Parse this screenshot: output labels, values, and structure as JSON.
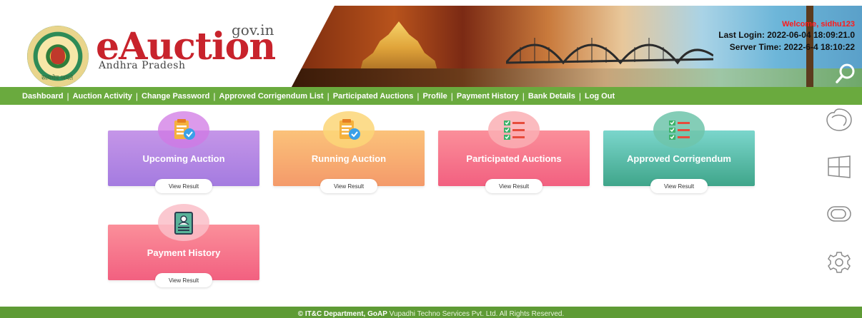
{
  "header": {
    "brand": "eAuction",
    "domain_suffix": "gov.in",
    "state": "Andhra Pradesh",
    "seal_tagline": "सत्यमेव जयते",
    "welcome": "Welcome, sidhu123",
    "last_login": "Last Login: 2022-06-04 18:09:21.0",
    "server_time": "Server Time: 2022-6-4 18:10:22",
    "search_icon": "search-icon"
  },
  "nav": {
    "items": [
      {
        "label": "Dashboard"
      },
      {
        "label": "Auction Activity"
      },
      {
        "label": "Change Password"
      },
      {
        "label": "Approved Corrigendum List"
      },
      {
        "label": "Participated Auctions"
      },
      {
        "label": "Profile"
      },
      {
        "label": "Payment History"
      },
      {
        "label": "Bank Details"
      },
      {
        "label": "Log Out"
      }
    ]
  },
  "cards": [
    {
      "title": "Upcoming Auction",
      "button": "View Result",
      "icon": "clipboard-check-icon"
    },
    {
      "title": "Running Auction",
      "button": "View Result",
      "icon": "clipboard-check-icon"
    },
    {
      "title": "Participated Auctions",
      "button": "View Result",
      "icon": "checklist-icon"
    },
    {
      "title": "Approved Corrigendum",
      "button": "View Result",
      "icon": "checklist-icon"
    },
    {
      "title": "Payment History",
      "button": "View Result",
      "icon": "id-card-icon"
    }
  ],
  "rail": {
    "icons": [
      "browser-icon",
      "windows-icon",
      "toggle-icon",
      "settings-gear-icon"
    ]
  },
  "footer": {
    "bold_text": "© IT&C Department, GoAP",
    "text": " Vupadhi Techno Services Pvt. Ltd. All Rights Reserved."
  },
  "colors": {
    "nav_green": "#6aaa3e",
    "brand_red": "#c8232c",
    "welcome_red": "#ff1a1a"
  }
}
